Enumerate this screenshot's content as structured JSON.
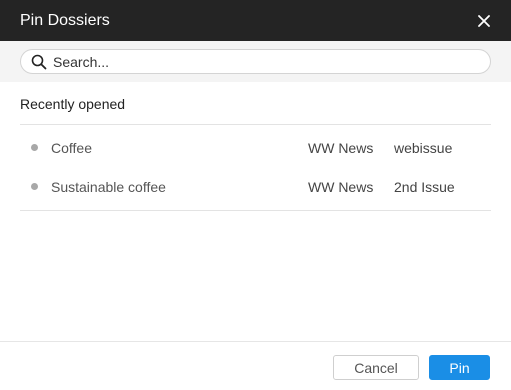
{
  "dialog": {
    "title": "Pin Dossiers",
    "close_icon": "close-icon"
  },
  "search": {
    "placeholder": "Search...",
    "value": "",
    "icon": "search-icon"
  },
  "recent": {
    "heading": "Recently opened",
    "items": [
      {
        "name": "Coffee",
        "publication": "WW News",
        "issue": "webissue"
      },
      {
        "name": "Sustainable coffee",
        "publication": "WW News",
        "issue": "2nd Issue"
      }
    ]
  },
  "footer": {
    "cancel_label": "Cancel",
    "pin_label": "Pin"
  },
  "colors": {
    "titlebar_bg": "#242424",
    "primary_button": "#1a8ee6",
    "search_bar_bg": "#f4f4f4"
  }
}
